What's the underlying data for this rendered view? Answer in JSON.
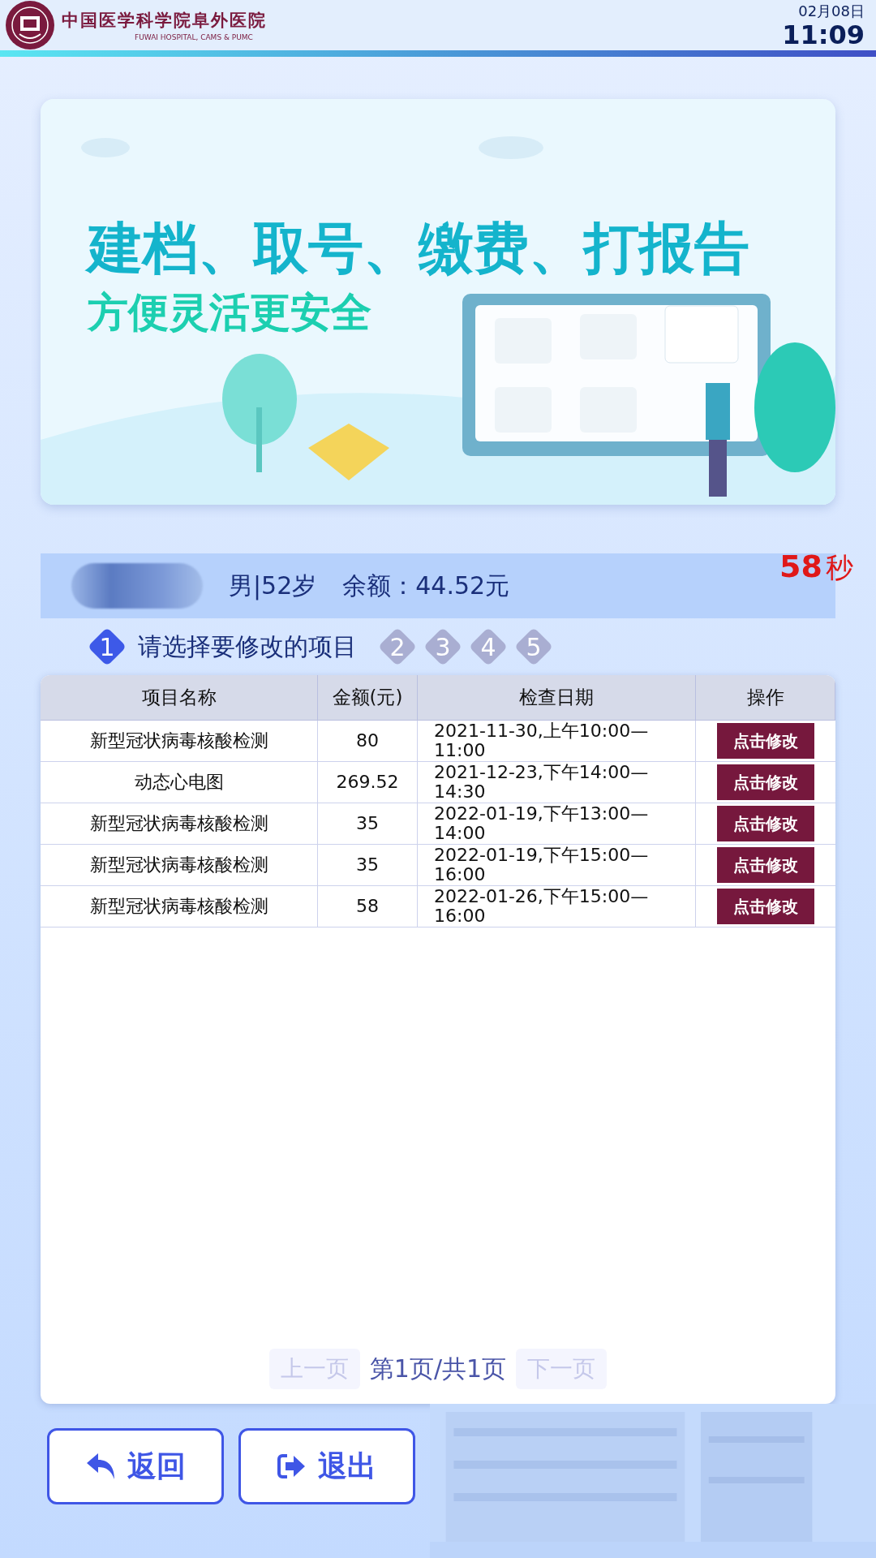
{
  "header": {
    "hospital_name": "中国医学科学院阜外医院",
    "hospital_name_en": "FUWAI HOSPITAL, CAMS & PUMC",
    "date": "02月08日",
    "time": "11:09"
  },
  "banner": {
    "kind": "picture",
    "headline": "建档、取号、缴费、打报告",
    "subline": "方便灵活更安全"
  },
  "patient": {
    "details": "男|52岁",
    "balance": "余额：44.52元"
  },
  "countdown": {
    "value": "58",
    "unit": "秒"
  },
  "steps": [
    {
      "number": "1",
      "selected": true,
      "caption": "请选择要修改的项目"
    },
    {
      "number": "2",
      "selected": false
    },
    {
      "number": "3",
      "selected": false
    },
    {
      "number": "4",
      "selected": false
    },
    {
      "number": "5",
      "selected": false
    }
  ],
  "table": {
    "columns": [
      "项目名称",
      "金额(元)",
      "检查日期",
      "操作"
    ],
    "rows": [
      {
        "name": "新型冠状病毒核酸检测",
        "amount": "80",
        "date": "2021-11-30,上午10:00—11:00",
        "action": "点击修改"
      },
      {
        "name": "动态心电图",
        "amount": "269.52",
        "date": "2021-12-23,下午14:00—14:30",
        "action": "点击修改"
      },
      {
        "name": "新型冠状病毒核酸检测",
        "amount": "35",
        "date": "2022-01-19,下午13:00—14:00",
        "action": "点击修改"
      },
      {
        "name": "新型冠状病毒核酸检测",
        "amount": "35",
        "date": "2022-01-19,下午15:00—16:00",
        "action": "点击修改"
      },
      {
        "name": "新型冠状病毒核酸检测",
        "amount": "58",
        "date": "2022-01-26,下午15:00—16:00",
        "action": "点击修改"
      }
    ]
  },
  "pagination": {
    "prev": {
      "label": "上一页",
      "disabled": true
    },
    "status": "第1页/共1页",
    "next": {
      "label": "下一页",
      "disabled": true
    }
  },
  "buttons": [
    {
      "kind": "back",
      "label": "返回"
    },
    {
      "kind": "exit",
      "label": "退出"
    }
  ]
}
